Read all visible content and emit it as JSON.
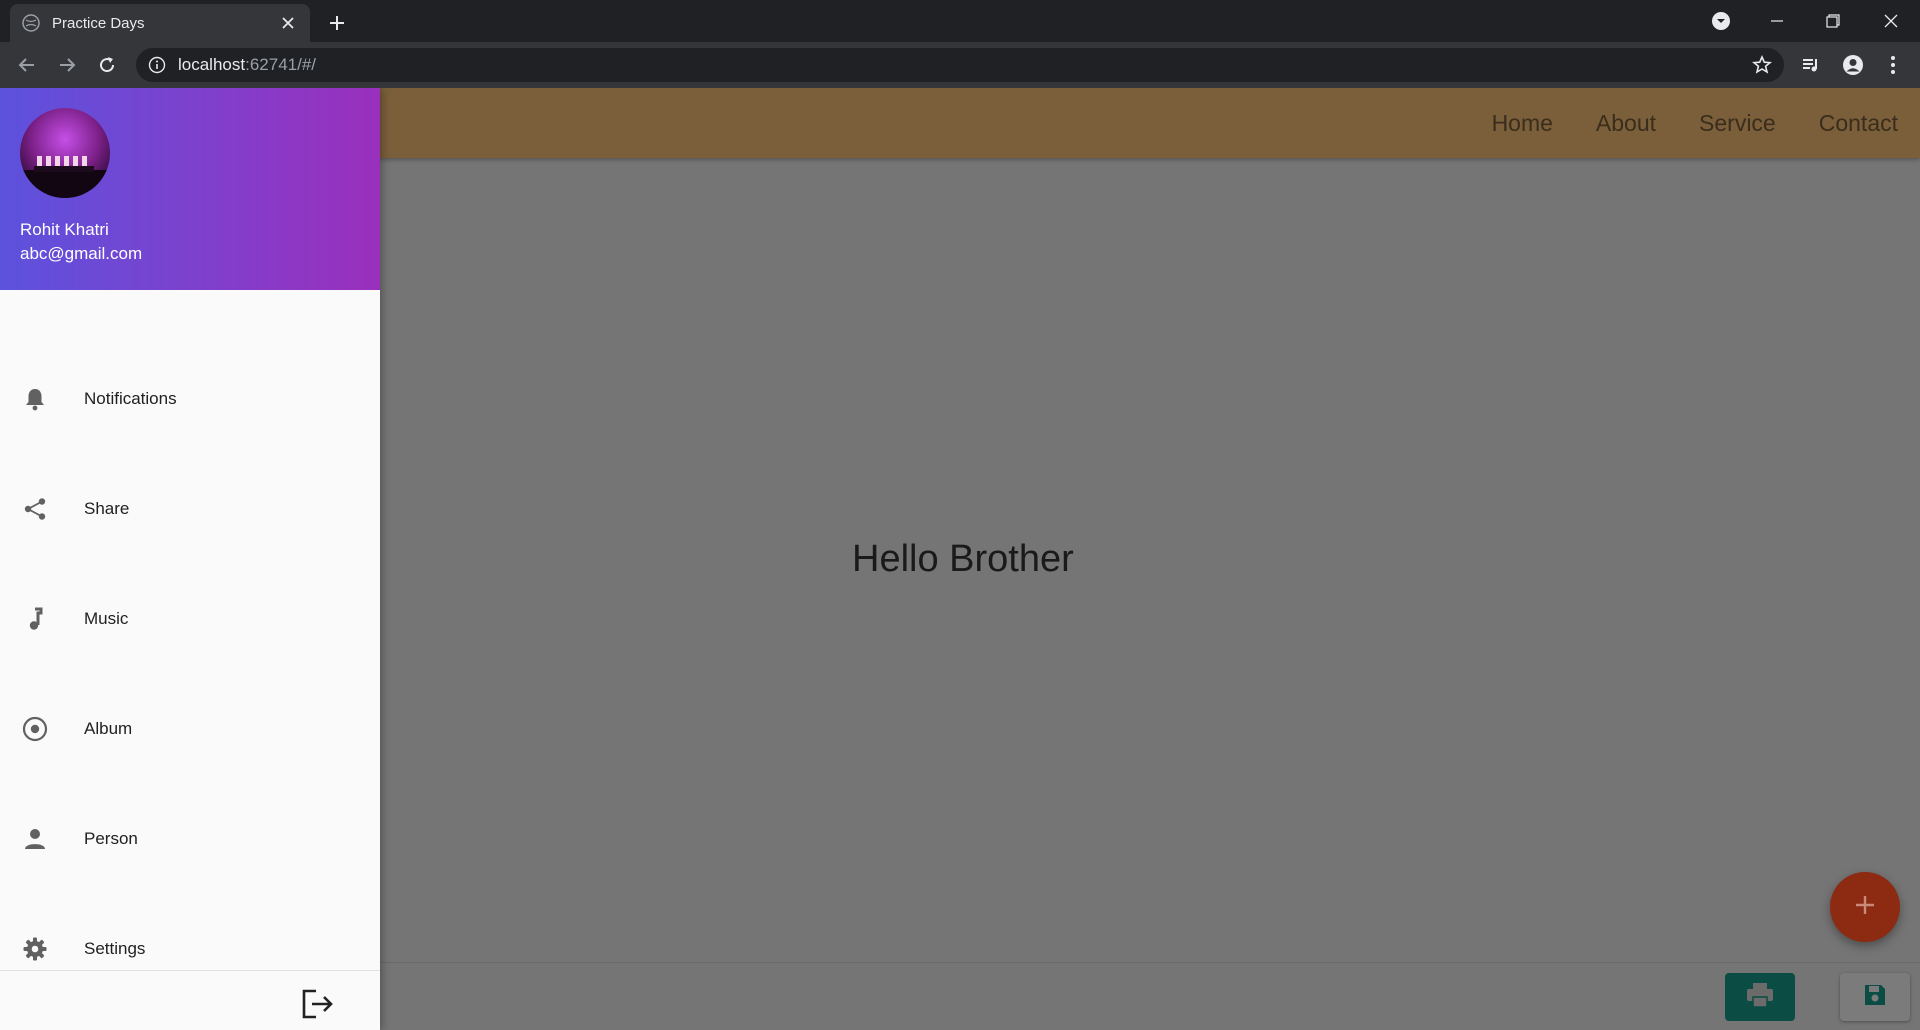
{
  "browser": {
    "tab_title": "Practice Days",
    "url_host": "localhost",
    "url_path": ":62741/#/"
  },
  "appbar": {
    "nav": [
      "Home",
      "About",
      "Service",
      "Contact"
    ],
    "color": "#7a5f3a"
  },
  "body": {
    "text": "Hello Brother"
  },
  "drawer": {
    "user_name": "Rohit Khatri",
    "user_email": "abc@gmail.com",
    "header_gradient": [
      "#5c52dd",
      "#9a2fbd"
    ],
    "items": [
      {
        "label": "Notifications",
        "icon": "bell-icon"
      },
      {
        "label": "Share",
        "icon": "share-icon"
      },
      {
        "label": "Music",
        "icon": "music-note-icon"
      },
      {
        "label": "Album",
        "icon": "album-icon"
      },
      {
        "label": "Person",
        "icon": "person-icon"
      },
      {
        "label": "Settings",
        "icon": "settings-icon"
      }
    ],
    "logout_icon": "logout-icon"
  },
  "fab": {
    "icon": "add-icon",
    "color": "#8c2a12"
  },
  "bottom_bar": {
    "print_icon": "print-icon",
    "print_color": "#0b4d44",
    "save_icon": "save-icon"
  }
}
